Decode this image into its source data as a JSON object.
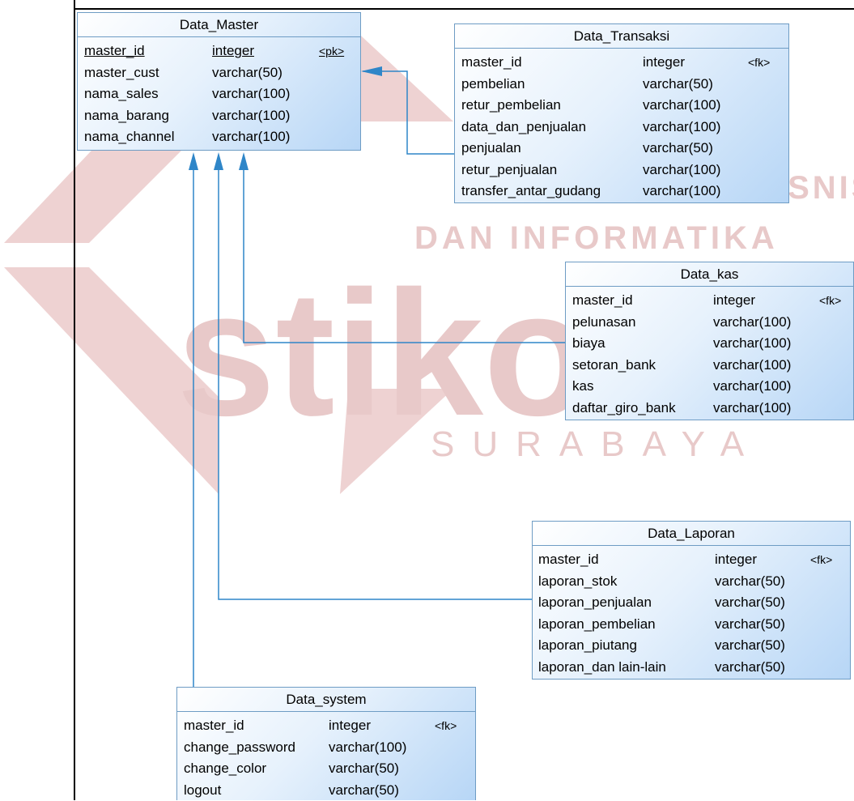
{
  "watermark": {
    "word": "stikom",
    "line1": "INSTITUT BISNIS",
    "line2": "DAN INFORMATIKA",
    "line3": "SURABAYA"
  },
  "entities": {
    "master": {
      "title": "Data_Master",
      "rows": [
        {
          "name": "master_id",
          "type": "integer",
          "key": "<pk>"
        },
        {
          "name": "master_cust",
          "type": "varchar(50)",
          "key": ""
        },
        {
          "name": "nama_sales",
          "type": "varchar(100)",
          "key": ""
        },
        {
          "name": "nama_barang",
          "type": "varchar(100)",
          "key": ""
        },
        {
          "name": "nama_channel",
          "type": "varchar(100)",
          "key": ""
        }
      ]
    },
    "transaksi": {
      "title": "Data_Transaksi",
      "rows": [
        {
          "name": "master_id",
          "type": "integer",
          "key": "<fk>"
        },
        {
          "name": "pembelian",
          "type": "varchar(50)",
          "key": ""
        },
        {
          "name": "retur_pembelian",
          "type": "varchar(100)",
          "key": ""
        },
        {
          "name": "data_dan_penjualan",
          "type": "varchar(100)",
          "key": ""
        },
        {
          "name": "penjualan",
          "type": "varchar(50)",
          "key": ""
        },
        {
          "name": "retur_penjualan",
          "type": "varchar(100)",
          "key": ""
        },
        {
          "name": "transfer_antar_gudang",
          "type": "varchar(100)",
          "key": ""
        }
      ]
    },
    "kas": {
      "title": "Data_kas",
      "rows": [
        {
          "name": "master_id",
          "type": "integer",
          "key": "<fk>"
        },
        {
          "name": "pelunasan",
          "type": "varchar(100)",
          "key": ""
        },
        {
          "name": "biaya",
          "type": "varchar(100)",
          "key": ""
        },
        {
          "name": "setoran_bank",
          "type": "varchar(100)",
          "key": ""
        },
        {
          "name": "kas",
          "type": "varchar(100)",
          "key": ""
        },
        {
          "name": "daftar_giro_bank",
          "type": "varchar(100)",
          "key": ""
        }
      ]
    },
    "laporan": {
      "title": "Data_Laporan",
      "rows": [
        {
          "name": "master_id",
          "type": "integer",
          "key": "<fk>"
        },
        {
          "name": "laporan_stok",
          "type": "varchar(50)",
          "key": ""
        },
        {
          "name": "laporan_penjualan",
          "type": "varchar(50)",
          "key": ""
        },
        {
          "name": "laporan_pembelian",
          "type": "varchar(50)",
          "key": ""
        },
        {
          "name": "laporan_piutang",
          "type": "varchar(50)",
          "key": ""
        },
        {
          "name": "laporan_dan lain-lain",
          "type": "varchar(50)",
          "key": ""
        }
      ]
    },
    "system": {
      "title": "Data_system",
      "rows": [
        {
          "name": "master_id",
          "type": "integer",
          "key": "<fk>"
        },
        {
          "name": "change_password",
          "type": "varchar(100)",
          "key": ""
        },
        {
          "name": "change_color",
          "type": "varchar(50)",
          "key": ""
        },
        {
          "name": "logout",
          "type": "varchar(50)",
          "key": ""
        }
      ]
    }
  },
  "colors": {
    "connector": "#2f86c8",
    "watermark": "#e8c9c9"
  }
}
